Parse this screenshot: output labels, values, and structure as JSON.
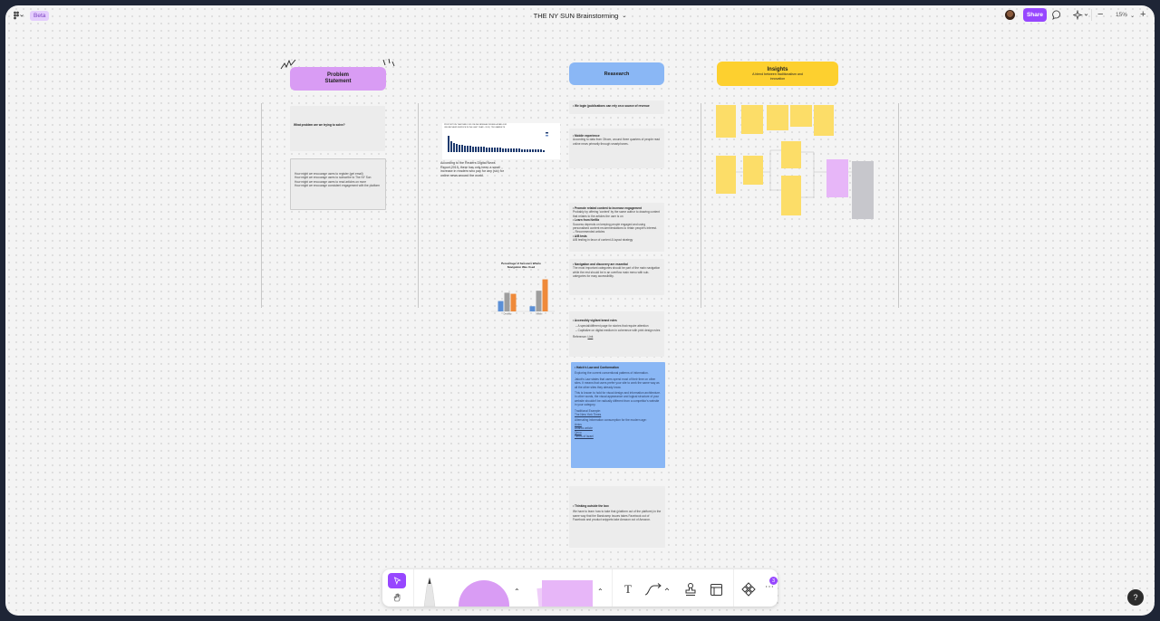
{
  "topbar": {
    "beta": "Beta",
    "file_title": "THE NY SUN Brainstorming",
    "share_label": "Share",
    "zoom": "15%"
  },
  "sections": {
    "problem": "Problem Statement",
    "research": "Reasearch",
    "insights_title": "Insights",
    "insights_subtitle": "A blend between traditionalism and innovation"
  },
  "problem": {
    "question": "What problem are we trying to solve?",
    "hmw": [
      "How might we encourage users to register (get email)",
      "How might we encourage users to subscribe to The NY Sun",
      "How might we encourage users to read articles on more",
      "How might we encourage consistent engagement with the platform"
    ]
  },
  "research_left": {
    "chart_title": "PROPORTION THAT PAID FOR ONLINE NEWS/ACCESSED A PAID-FOR ONLINE NEWS SERVICE IN THE LAST YEAR - 2019 | TWO MARKETS",
    "quote": "According to the Reuters Digital News Report 2019, there has only been a small increase in readers who pay for any (sic) for online news around the world.",
    "bar_title": "Percentage of Sessions Where Navigation Was Used"
  },
  "research_cards": {
    "c1": "We login (publications can rely on a source of revenue",
    "c2_title": "Mobile experience",
    "c2_body": "According to data from Ofcom, around three quarters of people read online news primarily through smartphones.",
    "c3_title": "Promote related content to increase engagement",
    "c3_body": "Probably by offering 'content' by the same author to drawing content that relates to the articles the user is on",
    "c3_title2": "Learn from Netflix",
    "c3_body2": "Success depends on keeping people engaged and using personalised content recommendations to retain people's interest.",
    "c3_item": "Recommended articles",
    "c3_title3": "A/B tests",
    "c3_body3": "A/B testing in favor of content & layout strategy",
    "c4_title": "Navigation and discovery are essential",
    "c4_body": "The most important categories should be part of the main navigation while the rest should be in an overflow main menu with sub-categories for easy accessibility.",
    "c5_title": "Accessibly vigilant brand rules",
    "c5_items": [
      "A special/different page for stories that require attention",
      "Capitalize on digital medium in coherence with print design rules"
    ],
    "c5_ref_label": "Reference:",
    "c5_ref_link": "Link",
    "c6_title": "Hatch's Law and Conformation",
    "c6_lines": [
      "Exploring the current conventional patterns of information.",
      "Jakob's Law states that users spend most of their time on other sites. It means that users prefer your site to work the same way as all the other sites they already know.",
      "This is known to hold for visual design and information architecture. In other words, the visual appearance and logical structure of your website shouldn't be radically different from a competitor's website in your category.",
      "Traditional Example:",
      "The New York Times",
      "Alternating information consumption for the modern age:",
      "Axios",
      "Atlantic article",
      "Qnvo",
      "Times of Israel"
    ],
    "c7_title": "Thinking outside the box",
    "c7_body": "We have to learn how to take that (platform out of the platform) in the same way that the Bandcamp Issues takes Facebook out of Facebook and product snippets take Amazon out of Amazon."
  },
  "toolbar": {
    "badge": "3",
    "text_tool": "T"
  },
  "help_label": "?",
  "chart_data": {
    "type": "bar",
    "title": "Percentage of Sessions Where Navigation Was Used",
    "categories": [
      "Desktop",
      "Mobile"
    ],
    "series": [
      {
        "name": "",
        "values": [
          10,
          5
        ],
        "color": "#5b8fd6"
      },
      {
        "name": "",
        "values": [
          18,
          20
        ],
        "color": "#9e9e9e"
      },
      {
        "name": "",
        "values": [
          17,
          31
        ],
        "color": "#ef8a3a"
      }
    ],
    "ylim": [
      0,
      35
    ]
  }
}
